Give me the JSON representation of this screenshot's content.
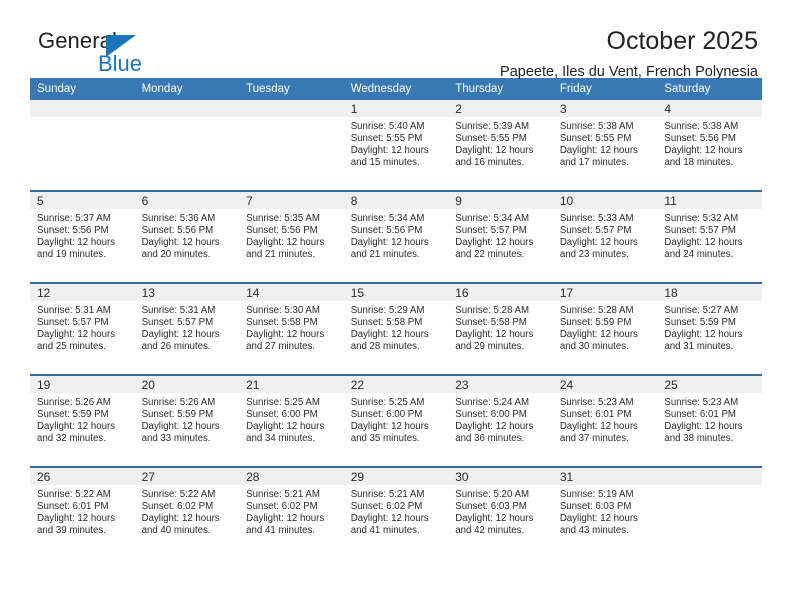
{
  "brand": {
    "name_top": "General",
    "name_bottom": "Blue",
    "triangle_color": "#1b75bb",
    "text_color": "#231f20"
  },
  "header": {
    "title": "October 2025",
    "subtitle": "Papeete, Iles du Vent, French Polynesia"
  },
  "theme": {
    "header_blue": "#3878b4",
    "row_divider_blue": "#31699c",
    "daynum_band_gray": "#efefef",
    "text_color": "#2b2b2b"
  },
  "calendar": {
    "weekday_headers": [
      "Sunday",
      "Monday",
      "Tuesday",
      "Wednesday",
      "Thursday",
      "Friday",
      "Saturday"
    ],
    "weeks": [
      [
        {
          "day": "",
          "lines": []
        },
        {
          "day": "",
          "lines": []
        },
        {
          "day": "",
          "lines": []
        },
        {
          "day": "1",
          "lines": [
            "Sunrise: 5:40 AM",
            "Sunset: 5:55 PM",
            "Daylight: 12 hours",
            "and 15 minutes."
          ]
        },
        {
          "day": "2",
          "lines": [
            "Sunrise: 5:39 AM",
            "Sunset: 5:55 PM",
            "Daylight: 12 hours",
            "and 16 minutes."
          ]
        },
        {
          "day": "3",
          "lines": [
            "Sunrise: 5:38 AM",
            "Sunset: 5:55 PM",
            "Daylight: 12 hours",
            "and 17 minutes."
          ]
        },
        {
          "day": "4",
          "lines": [
            "Sunrise: 5:38 AM",
            "Sunset: 5:56 PM",
            "Daylight: 12 hours",
            "and 18 minutes."
          ]
        }
      ],
      [
        {
          "day": "5",
          "lines": [
            "Sunrise: 5:37 AM",
            "Sunset: 5:56 PM",
            "Daylight: 12 hours",
            "and 19 minutes."
          ]
        },
        {
          "day": "6",
          "lines": [
            "Sunrise: 5:36 AM",
            "Sunset: 5:56 PM",
            "Daylight: 12 hours",
            "and 20 minutes."
          ]
        },
        {
          "day": "7",
          "lines": [
            "Sunrise: 5:35 AM",
            "Sunset: 5:56 PM",
            "Daylight: 12 hours",
            "and 21 minutes."
          ]
        },
        {
          "day": "8",
          "lines": [
            "Sunrise: 5:34 AM",
            "Sunset: 5:56 PM",
            "Daylight: 12 hours",
            "and 21 minutes."
          ]
        },
        {
          "day": "9",
          "lines": [
            "Sunrise: 5:34 AM",
            "Sunset: 5:57 PM",
            "Daylight: 12 hours",
            "and 22 minutes."
          ]
        },
        {
          "day": "10",
          "lines": [
            "Sunrise: 5:33 AM",
            "Sunset: 5:57 PM",
            "Daylight: 12 hours",
            "and 23 minutes."
          ]
        },
        {
          "day": "11",
          "lines": [
            "Sunrise: 5:32 AM",
            "Sunset: 5:57 PM",
            "Daylight: 12 hours",
            "and 24 minutes."
          ]
        }
      ],
      [
        {
          "day": "12",
          "lines": [
            "Sunrise: 5:31 AM",
            "Sunset: 5:57 PM",
            "Daylight: 12 hours",
            "and 25 minutes."
          ]
        },
        {
          "day": "13",
          "lines": [
            "Sunrise: 5:31 AM",
            "Sunset: 5:57 PM",
            "Daylight: 12 hours",
            "and 26 minutes."
          ]
        },
        {
          "day": "14",
          "lines": [
            "Sunrise: 5:30 AM",
            "Sunset: 5:58 PM",
            "Daylight: 12 hours",
            "and 27 minutes."
          ]
        },
        {
          "day": "15",
          "lines": [
            "Sunrise: 5:29 AM",
            "Sunset: 5:58 PM",
            "Daylight: 12 hours",
            "and 28 minutes."
          ]
        },
        {
          "day": "16",
          "lines": [
            "Sunrise: 5:28 AM",
            "Sunset: 5:58 PM",
            "Daylight: 12 hours",
            "and 29 minutes."
          ]
        },
        {
          "day": "17",
          "lines": [
            "Sunrise: 5:28 AM",
            "Sunset: 5:59 PM",
            "Daylight: 12 hours",
            "and 30 minutes."
          ]
        },
        {
          "day": "18",
          "lines": [
            "Sunrise: 5:27 AM",
            "Sunset: 5:59 PM",
            "Daylight: 12 hours",
            "and 31 minutes."
          ]
        }
      ],
      [
        {
          "day": "19",
          "lines": [
            "Sunrise: 5:26 AM",
            "Sunset: 5:59 PM",
            "Daylight: 12 hours",
            "and 32 minutes."
          ]
        },
        {
          "day": "20",
          "lines": [
            "Sunrise: 5:26 AM",
            "Sunset: 5:59 PM",
            "Daylight: 12 hours",
            "and 33 minutes."
          ]
        },
        {
          "day": "21",
          "lines": [
            "Sunrise: 5:25 AM",
            "Sunset: 6:00 PM",
            "Daylight: 12 hours",
            "and 34 minutes."
          ]
        },
        {
          "day": "22",
          "lines": [
            "Sunrise: 5:25 AM",
            "Sunset: 6:00 PM",
            "Daylight: 12 hours",
            "and 35 minutes."
          ]
        },
        {
          "day": "23",
          "lines": [
            "Sunrise: 5:24 AM",
            "Sunset: 6:00 PM",
            "Daylight: 12 hours",
            "and 36 minutes."
          ]
        },
        {
          "day": "24",
          "lines": [
            "Sunrise: 5:23 AM",
            "Sunset: 6:01 PM",
            "Daylight: 12 hours",
            "and 37 minutes."
          ]
        },
        {
          "day": "25",
          "lines": [
            "Sunrise: 5:23 AM",
            "Sunset: 6:01 PM",
            "Daylight: 12 hours",
            "and 38 minutes."
          ]
        }
      ],
      [
        {
          "day": "26",
          "lines": [
            "Sunrise: 5:22 AM",
            "Sunset: 6:01 PM",
            "Daylight: 12 hours",
            "and 39 minutes."
          ]
        },
        {
          "day": "27",
          "lines": [
            "Sunrise: 5:22 AM",
            "Sunset: 6:02 PM",
            "Daylight: 12 hours",
            "and 40 minutes."
          ]
        },
        {
          "day": "28",
          "lines": [
            "Sunrise: 5:21 AM",
            "Sunset: 6:02 PM",
            "Daylight: 12 hours",
            "and 41 minutes."
          ]
        },
        {
          "day": "29",
          "lines": [
            "Sunrise: 5:21 AM",
            "Sunset: 6:02 PM",
            "Daylight: 12 hours",
            "and 41 minutes."
          ]
        },
        {
          "day": "30",
          "lines": [
            "Sunrise: 5:20 AM",
            "Sunset: 6:03 PM",
            "Daylight: 12 hours",
            "and 42 minutes."
          ]
        },
        {
          "day": "31",
          "lines": [
            "Sunrise: 5:19 AM",
            "Sunset: 6:03 PM",
            "Daylight: 12 hours",
            "and 43 minutes."
          ]
        },
        {
          "day": "",
          "lines": []
        }
      ]
    ]
  }
}
